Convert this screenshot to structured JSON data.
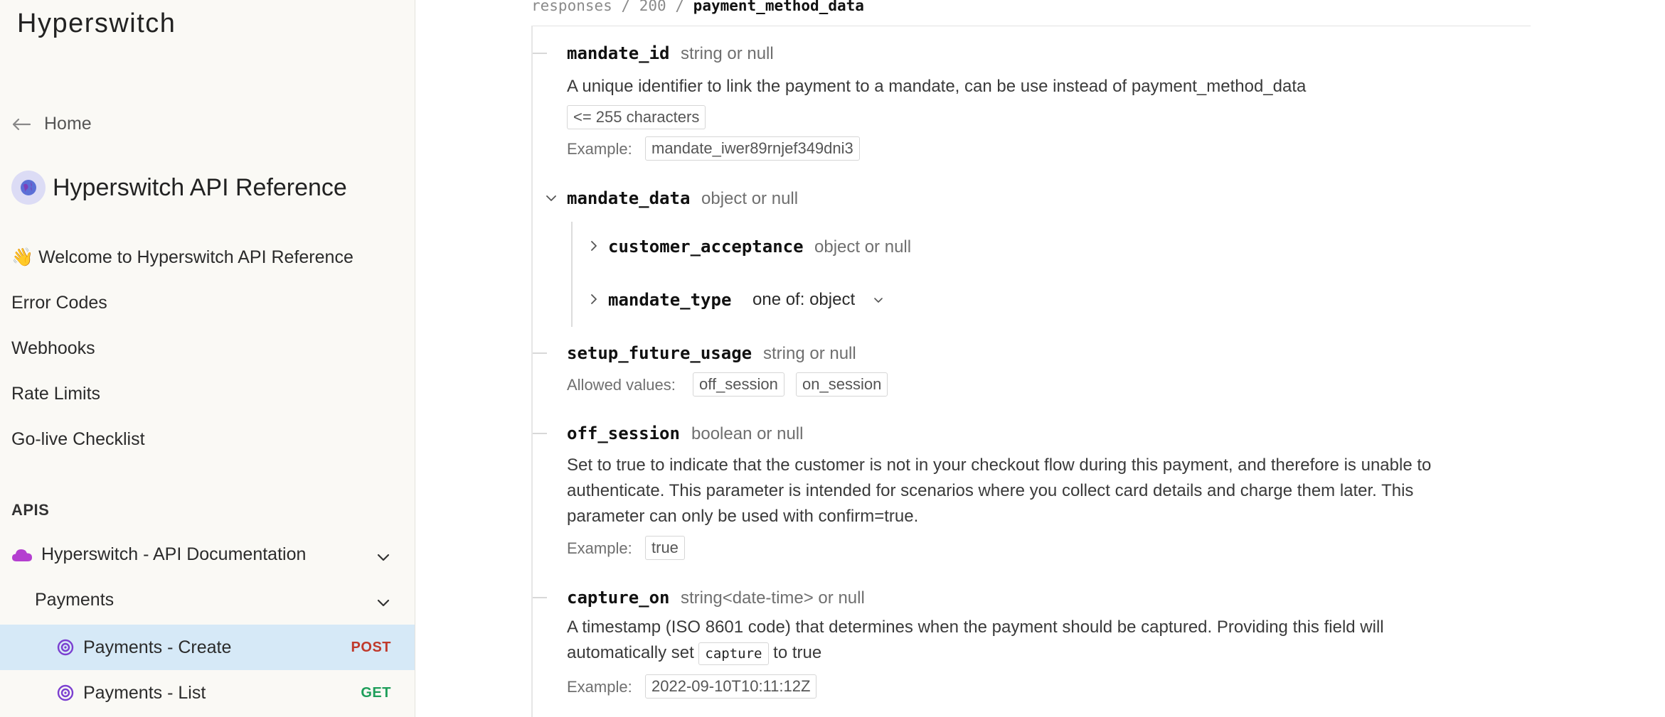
{
  "sidebar": {
    "brand": "Hyperswitch",
    "home_label": "Home",
    "api_reference_title": "Hyperswitch API Reference",
    "nav_items": [
      "👋 Welcome to Hyperswitch API Reference",
      "Error Codes",
      "Webhooks",
      "Rate Limits",
      "Go-live Checklist"
    ],
    "section_label": "APIS",
    "group_label": "Hyperswitch - API Documentation",
    "subgroup_label": "Payments",
    "endpoints": [
      {
        "label": "Payments - Create",
        "method": "POST",
        "method_color": "#c0392b",
        "active": true
      },
      {
        "label": "Payments - List",
        "method": "GET",
        "method_color": "#1e9e5a",
        "active": false
      }
    ],
    "active_bg": "#d6e9f7"
  },
  "breadcrumb": {
    "part1": "responses",
    "sep": "/",
    "part2": "200",
    "current": "payment_method_data"
  },
  "fields": {
    "mandate_id": {
      "name": "mandate_id",
      "type": "string or null",
      "description": "A unique identifier to link the payment to a mandate, can be use instead of payment_method_data",
      "constraint": "<= 255 characters",
      "example_label": "Example:",
      "example": "mandate_iwer89rnjef349dni3"
    },
    "mandate_data": {
      "name": "mandate_data",
      "type": "object or null",
      "children": {
        "customer_acceptance": {
          "name": "customer_acceptance",
          "type": "object or null"
        },
        "mandate_type": {
          "name": "mandate_type",
          "type": "one of: object"
        }
      }
    },
    "setup_future_usage": {
      "name": "setup_future_usage",
      "type": "string or null",
      "allowed_label": "Allowed values:",
      "allowed_values": [
        "off_session",
        "on_session"
      ]
    },
    "off_session": {
      "name": "off_session",
      "type": "boolean or null",
      "description_line1": "Set to true to indicate that the customer is not in your checkout flow during this payment, and therefore is unable to",
      "description_line2": "authenticate. This parameter is intended for scenarios where you collect card details and charge them later. This",
      "description_line3": "parameter can only be used with confirm=true.",
      "example_label": "Example:",
      "example": "true"
    },
    "capture_on": {
      "name": "capture_on",
      "type": "string<date-time> or null",
      "description_line1": "A timestamp (ISO 8601 code) that determines when the payment should be captured. Providing this field will",
      "description_line2_pre": "automatically set",
      "description_line2_code": "capture",
      "description_line2_post": "to true",
      "example_label": "Example:",
      "example": "2022-09-10T10:11:12Z"
    }
  }
}
